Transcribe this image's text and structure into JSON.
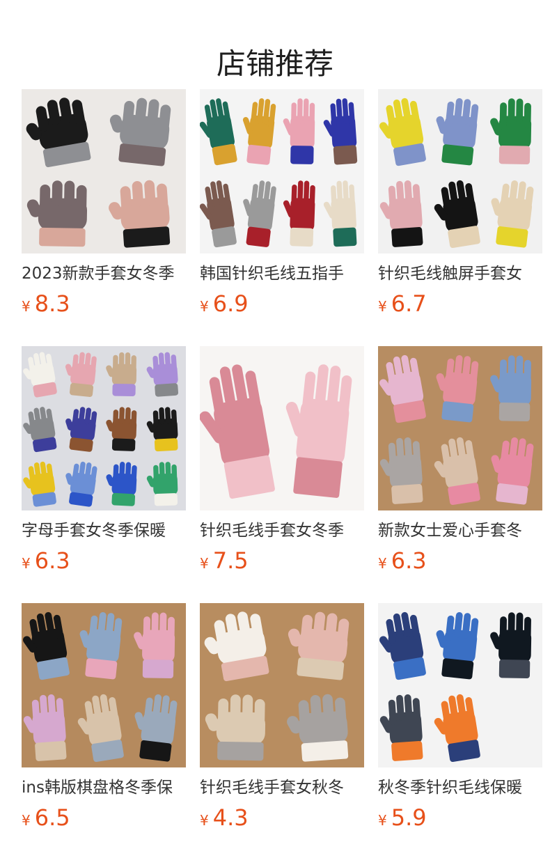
{
  "section": {
    "title": "店铺推荐"
  },
  "colors": {
    "price": "#e7501a",
    "title_text": "#333333",
    "heading_text": "#1e1e1e"
  },
  "products": [
    {
      "title": "2023新款手套女冬季",
      "currency": "¥",
      "price": "8.3",
      "image": "gloves-product-photo",
      "bg": "#ece9e6",
      "glove_colors": [
        "#1b1b1b",
        "#8e8f93",
        "#77686a",
        "#d8a79a"
      ]
    },
    {
      "title": "韩国针织毛线五指手",
      "currency": "¥",
      "price": "6.9",
      "image": "gloves-product-photo",
      "bg": "#f4f4f4",
      "glove_colors": [
        "#1e6c58",
        "#d9a12f",
        "#eaa3b2",
        "#2f36a8",
        "#7b5a4f",
        "#9a9a9a",
        "#a8202a",
        "#e7dbc7"
      ]
    },
    {
      "title": "针织毛线触屏手套女",
      "currency": "¥",
      "price": "6.7",
      "image": "gloves-product-photo",
      "bg": "#f1f1f1",
      "glove_colors": [
        "#e5d42c",
        "#7f93c9",
        "#248743",
        "#e1aab0",
        "#141414",
        "#e4d2b4"
      ]
    },
    {
      "title": "字母手套女冬季保暖",
      "currency": "¥",
      "price": "6.3",
      "image": "gloves-product-photo",
      "bg": "#dcdde2",
      "glove_colors": [
        "#f3f1ea",
        "#e6a6b0",
        "#c8ac8d",
        "#a98ed8",
        "#86888b",
        "#3d3e9b",
        "#8b5431",
        "#1b1b1b",
        "#e7c21e",
        "#6b8fd6",
        "#2c55c8",
        "#32a36b"
      ]
    },
    {
      "title": "针织毛线手套女冬季",
      "currency": "¥",
      "price": "7.5",
      "image": "gloves-product-photo",
      "bg": "#f7f5f3",
      "glove_colors": [
        "#d98a96",
        "#f1c0c8"
      ]
    },
    {
      "title": "新款女士爱心手套冬",
      "currency": "¥",
      "price": "6.3",
      "image": "gloves-product-photo",
      "bg": "#b78d62",
      "glove_colors": [
        "#e6b6cf",
        "#e48f9c",
        "#7a9ac9",
        "#aaa5a3",
        "#d9c0aa",
        "#e78aa2"
      ]
    },
    {
      "title": "ins韩版棋盘格冬季保",
      "currency": "¥",
      "price": "6.5",
      "image": "gloves-product-photo",
      "bg": "#b58a5e",
      "glove_colors": [
        "#161616",
        "#8ca6c6",
        "#e8a6ba",
        "#d6a8cf",
        "#d8c3aa",
        "#9aa9bb"
      ]
    },
    {
      "title": "针织毛线手套女秋冬",
      "currency": "¥",
      "price": "4.3",
      "image": "gloves-product-photo",
      "bg": "#b88d60",
      "glove_colors": [
        "#f4efe8",
        "#e4b7ad",
        "#dccab2",
        "#a6a2a0"
      ]
    },
    {
      "title": "秋冬季针织毛线保暖",
      "currency": "¥",
      "price": "5.9",
      "image": "gloves-product-photo",
      "bg": "#f3f3f3",
      "glove_colors": [
        "#2b3f7a",
        "#3a6fc4",
        "#101820",
        "#3f4653",
        "#ef7a2b"
      ]
    }
  ]
}
